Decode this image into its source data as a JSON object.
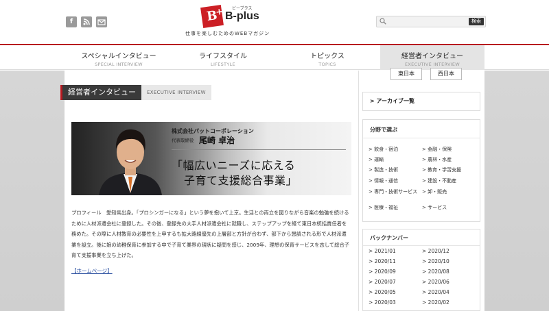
{
  "header": {
    "logo_mark": "B",
    "logo_plus": "+",
    "logo_name": "B-plus",
    "logo_ruby": "ビープラス",
    "tagline": "仕事を楽しむためのWEBマガジン",
    "search_button": "検索",
    "search_placeholder": ""
  },
  "nav": [
    {
      "jp": "スペシャルインタビュー",
      "en": "SPECIAL INTERVIEW"
    },
    {
      "jp": "ライフスタイル",
      "en": "LIFESTYLE"
    },
    {
      "jp": "トピックス",
      "en": "TOPICS"
    },
    {
      "jp": "経営者インタビュー",
      "en": "EXECUTIVE INTERVIEW"
    }
  ],
  "subnav": {
    "east": "東日本",
    "west": "西日本"
  },
  "section": {
    "jp": "経営者インタビュー",
    "en": "EXECUTIVE INTERVIEW"
  },
  "banner": {
    "company": "株式会社パットコーポレーション",
    "role": "代表取締役",
    "name": "尾崎 卓治",
    "catch1": "「幅広いニーズに応える",
    "catch2": "子育て支援総合事業」"
  },
  "profile": "プロフィール　愛知県出身。「プロシンガーになる」という夢を抱いて上京。生活との両立を図りながら音楽の勉強を続けるために人材派遣会社に登録した。その後、登録先の大手人材派遣会社に就職し、ステップアップを経て東日本統括責任者を務めた。その際に人材教育の必要性を上申するも拡大路線優先の上層部と方針が合わず、部下から懇請される形で人材派遣業を設立。後に娘の幼稚保育に参加する中で子育て業界の現状に疑問を感じ、2009年、理想の保育サービスを志して総合子育て支援事業を立ち上げた。",
  "homepage_link": "【ホームページ】",
  "sidebar": {
    "archive": "アーカイブ一覧",
    "field_title": "分野で選ぶ",
    "categories": [
      "飲食・宿泊",
      "金融・保険",
      "運輸",
      "農林・水産",
      "製造・技術",
      "教育・学習支援",
      "情報・通信",
      "建設・不動産",
      "専門・技術サービス",
      "卸・販売",
      "医療・福祉",
      "サービス"
    ],
    "back_title": "バックナンバー",
    "months": [
      "2021/01",
      "2020/12",
      "2020/11",
      "2020/10",
      "2020/09",
      "2020/08",
      "2020/07",
      "2020/06",
      "2020/05",
      "2020/04",
      "2020/03",
      "2020/02"
    ]
  }
}
